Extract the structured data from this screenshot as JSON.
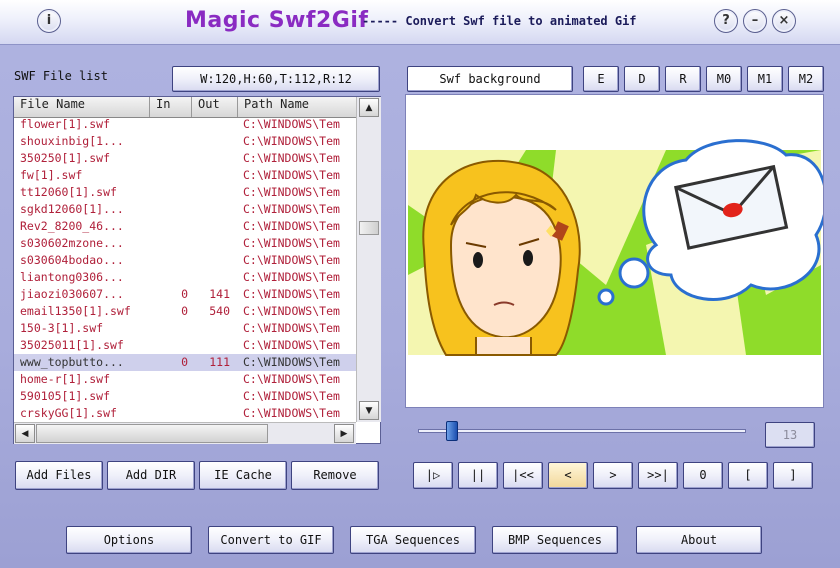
{
  "titlebar": {
    "info_button": "i",
    "app_title": "Magic  Swf2Gif",
    "subtitle": "-----  Convert Swf file to animated Gif",
    "help_button": "?",
    "minimize_button": "–",
    "close_button": "×"
  },
  "list": {
    "label": "SWF File list",
    "info_button": "W:120,H:60,T:112,R:12",
    "headers": [
      "File Name",
      "In",
      "Out",
      "Path Name"
    ],
    "rows": [
      {
        "name": "flower[1].swf",
        "in": "",
        "out": "",
        "path": "C:\\WINDOWS\\Tem"
      },
      {
        "name": "shouxinbig[1...",
        "in": "",
        "out": "",
        "path": "C:\\WINDOWS\\Tem"
      },
      {
        "name": "350250[1].swf",
        "in": "",
        "out": "",
        "path": "C:\\WINDOWS\\Tem"
      },
      {
        "name": "fw[1].swf",
        "in": "",
        "out": "",
        "path": "C:\\WINDOWS\\Tem"
      },
      {
        "name": "tt12060[1].swf",
        "in": "",
        "out": "",
        "path": "C:\\WINDOWS\\Tem"
      },
      {
        "name": "sgkd12060[1]...",
        "in": "",
        "out": "",
        "path": "C:\\WINDOWS\\Tem"
      },
      {
        "name": "Rev2_8200_46...",
        "in": "",
        "out": "",
        "path": "C:\\WINDOWS\\Tem"
      },
      {
        "name": "s030602mzone...",
        "in": "",
        "out": "",
        "path": "C:\\WINDOWS\\Tem"
      },
      {
        "name": "s030604bodao...",
        "in": "",
        "out": "",
        "path": "C:\\WINDOWS\\Tem"
      },
      {
        "name": "liantong0306...",
        "in": "",
        "out": "",
        "path": "C:\\WINDOWS\\Tem"
      },
      {
        "name": "jiaozi030607...",
        "in": "0",
        "out": "141",
        "path": "C:\\WINDOWS\\Tem"
      },
      {
        "name": "email1350[1].swf",
        "in": "0",
        "out": "540",
        "path": "C:\\WINDOWS\\Tem"
      },
      {
        "name": "150-3[1].swf",
        "in": "",
        "out": "",
        "path": "C:\\WINDOWS\\Tem"
      },
      {
        "name": "35025011[1].swf",
        "in": "",
        "out": "",
        "path": "C:\\WINDOWS\\Tem"
      },
      {
        "name": "www_topbutto...",
        "in": "0",
        "out": "111",
        "path": "C:\\WINDOWS\\Tem",
        "selected": true
      },
      {
        "name": "home-r[1].swf",
        "in": "",
        "out": "",
        "path": "C:\\WINDOWS\\Tem"
      },
      {
        "name": "590105[1].swf",
        "in": "",
        "out": "",
        "path": "C:\\WINDOWS\\Tem"
      },
      {
        "name": "crskyGG[1].swf",
        "in": "",
        "out": "",
        "path": "C:\\WINDOWS\\Tem"
      }
    ],
    "scroll_up": "▲",
    "scroll_down": "▼",
    "scroll_left": "◀",
    "scroll_right": "▶"
  },
  "list_buttons": {
    "add_files": "Add Files",
    "add_dir": "Add DIR",
    "ie_cache": "IE Cache",
    "remove": "Remove"
  },
  "preview": {
    "background_label": "Swf background",
    "buttons": [
      "E",
      "D",
      "R",
      "M0",
      "M1",
      "M2"
    ],
    "slider_position": 0.09,
    "frame_value": "13"
  },
  "playback": {
    "buttons": [
      "|▷",
      "||",
      "|<<",
      "<",
      ">",
      ">>|",
      "0",
      "[",
      "]"
    ]
  },
  "bottom": {
    "options": "Options",
    "convert_gif": "Convert to GIF",
    "tga": "TGA Sequences",
    "bmp": "BMP Sequences",
    "about": "About"
  },
  "colors": {
    "title": "#8a2bc2",
    "window": "#aeb2e0",
    "row_text": "#b0203a",
    "preview_green": "#8fdc2a"
  }
}
